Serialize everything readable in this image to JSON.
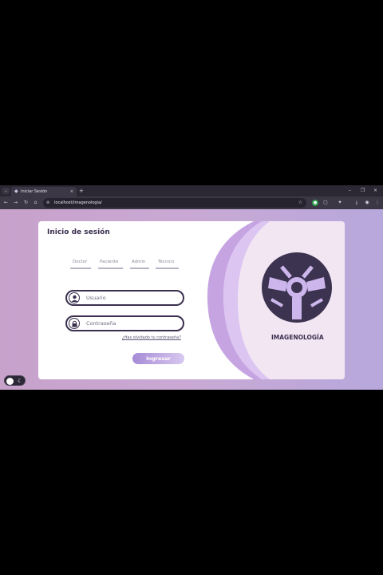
{
  "browser": {
    "tab_title": "Iniciar Sesión",
    "url": "localhost/imagenologia/",
    "close_tab": "×",
    "new_tab": "+",
    "window_controls": [
      "–",
      "❐",
      "×"
    ],
    "nav": [
      "←",
      "→",
      "↻",
      "⌂"
    ]
  },
  "login": {
    "title": "Inicio de sesión",
    "roles": [
      "Doctor",
      "Paciente",
      "Admin",
      "Técnico"
    ],
    "username_placeholder": "Usuario",
    "password_placeholder": "Contraseña",
    "forgot_link": "¿Has olvidado tu contraseña?",
    "submit_label": "Ingresar"
  },
  "brand": {
    "name": "IMAGENOLOGÍA",
    "accent": "#3a2f4f",
    "logo_bg": "#a78bd6"
  },
  "theme_toggle": {
    "icon": "moon-icon"
  }
}
